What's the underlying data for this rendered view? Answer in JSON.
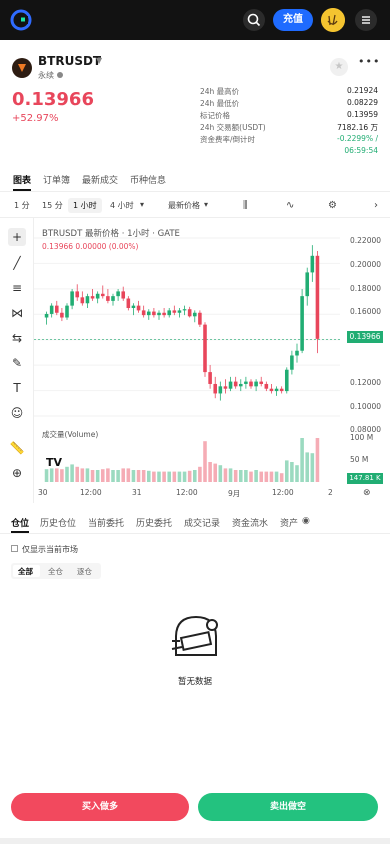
{
  "header": {
    "logo_icon": "gate-logo-icon",
    "search_icon": "search-icon",
    "deposit_label": "充值",
    "avatar_icon": "peace-hand-avatar",
    "menu_icon": "hamburger-menu-icon"
  },
  "ticker": {
    "symbol": "BTRUSDT",
    "type": "永续",
    "last_price": "0.13966",
    "change_pct": "+52.97%",
    "stats": [
      {
        "label": "24h 最高价",
        "value": "0.21924"
      },
      {
        "label": "24h 最低价",
        "value": "0.08229"
      },
      {
        "label": "标记价格",
        "value": "0.13959"
      },
      {
        "label": "24h 交易额(USDT)",
        "value": "7182.16 万"
      },
      {
        "label": "资金费率/倒计时",
        "value": "-0.2299% /"
      }
    ],
    "countdown": "06:59:54"
  },
  "tabs": [
    "图表",
    "订单簿",
    "最新成交",
    "币种信息"
  ],
  "toolbar": {
    "timeframes": [
      "1 分",
      "15 分",
      "1 小时",
      "4 小时"
    ],
    "active_tf": "1 小时",
    "price_type": "最新价格"
  },
  "chart": {
    "legend": "BTRUSDT 最新价格 · 1小时 · GATE",
    "legend_values": "0.13966  0.00000 (0.00%)",
    "volume_legend": "成交量(Volume)",
    "price_tag": "0.13966",
    "volume_tag": "147.81 K",
    "y_ticks": [
      "0.22000",
      "0.20000",
      "0.18000",
      "0.16000",
      "0.12000",
      "0.10000",
      "0.08000"
    ],
    "vol_ticks": [
      "100 M",
      "50 M"
    ],
    "x_ticks": [
      "30",
      "12:00",
      "31",
      "12:00",
      "9月",
      "12:00",
      "2"
    ]
  },
  "chart_data": {
    "type": "candlestick",
    "title": "BTRUSDT 最新价格 · 1小时 · GATE",
    "ylabel": "",
    "ylim": [
      0.075,
      0.225
    ],
    "candles": [
      [
        0.158,
        0.163,
        0.152,
        0.161
      ],
      [
        0.161,
        0.17,
        0.158,
        0.168
      ],
      [
        0.168,
        0.172,
        0.16,
        0.162
      ],
      [
        0.162,
        0.166,
        0.155,
        0.158
      ],
      [
        0.158,
        0.17,
        0.156,
        0.168
      ],
      [
        0.168,
        0.182,
        0.165,
        0.18
      ],
      [
        0.18,
        0.186,
        0.172,
        0.175
      ],
      [
        0.175,
        0.18,
        0.168,
        0.17
      ],
      [
        0.17,
        0.178,
        0.166,
        0.176
      ],
      [
        0.176,
        0.182,
        0.172,
        0.174
      ],
      [
        0.174,
        0.18,
        0.17,
        0.178
      ],
      [
        0.178,
        0.185,
        0.174,
        0.176
      ],
      [
        0.176,
        0.182,
        0.17,
        0.172
      ],
      [
        0.172,
        0.178,
        0.168,
        0.176
      ],
      [
        0.176,
        0.182,
        0.172,
        0.18
      ],
      [
        0.18,
        0.184,
        0.172,
        0.174
      ],
      [
        0.174,
        0.176,
        0.164,
        0.166
      ],
      [
        0.166,
        0.17,
        0.16,
        0.168
      ],
      [
        0.168,
        0.172,
        0.162,
        0.164
      ],
      [
        0.164,
        0.168,
        0.158,
        0.16
      ],
      [
        0.16,
        0.165,
        0.156,
        0.163
      ],
      [
        0.163,
        0.166,
        0.158,
        0.16
      ],
      [
        0.16,
        0.164,
        0.156,
        0.162
      ],
      [
        0.162,
        0.166,
        0.158,
        0.16
      ],
      [
        0.16,
        0.166,
        0.158,
        0.164
      ],
      [
        0.164,
        0.168,
        0.16,
        0.162
      ],
      [
        0.162,
        0.166,
        0.158,
        0.164
      ],
      [
        0.164,
        0.168,
        0.16,
        0.165
      ],
      [
        0.165,
        0.167,
        0.158,
        0.159
      ],
      [
        0.159,
        0.164,
        0.154,
        0.162
      ],
      [
        0.162,
        0.164,
        0.15,
        0.152
      ],
      [
        0.152,
        0.154,
        0.108,
        0.112
      ],
      [
        0.112,
        0.118,
        0.098,
        0.102
      ],
      [
        0.102,
        0.108,
        0.09,
        0.094
      ],
      [
        0.094,
        0.104,
        0.088,
        0.1
      ],
      [
        0.1,
        0.106,
        0.094,
        0.098
      ],
      [
        0.098,
        0.108,
        0.096,
        0.104
      ],
      [
        0.104,
        0.108,
        0.098,
        0.1
      ],
      [
        0.1,
        0.106,
        0.096,
        0.102
      ],
      [
        0.102,
        0.108,
        0.098,
        0.104
      ],
      [
        0.104,
        0.106,
        0.098,
        0.1
      ],
      [
        0.1,
        0.106,
        0.096,
        0.104
      ],
      [
        0.104,
        0.108,
        0.1,
        0.102
      ],
      [
        0.102,
        0.104,
        0.096,
        0.098
      ],
      [
        0.098,
        0.102,
        0.094,
        0.096
      ],
      [
        0.096,
        0.1,
        0.092,
        0.098
      ],
      [
        0.098,
        0.1,
        0.094,
        0.096
      ],
      [
        0.096,
        0.116,
        0.094,
        0.114
      ],
      [
        0.114,
        0.13,
        0.11,
        0.126
      ],
      [
        0.126,
        0.136,
        0.12,
        0.13
      ],
      [
        0.13,
        0.182,
        0.128,
        0.176
      ],
      [
        0.176,
        0.2,
        0.168,
        0.196
      ],
      [
        0.196,
        0.219,
        0.188,
        0.21
      ],
      [
        0.21,
        0.214,
        0.128,
        0.14
      ]
    ],
    "volume_ticks": [
      "100 M",
      "50 M"
    ]
  },
  "positions": {
    "tabs": [
      "仓位",
      "历史仓位",
      "当前委托",
      "历史委托",
      "成交记录",
      "资金流水",
      "资产"
    ],
    "only_current": "仅显示当前市场",
    "segments": [
      "全部",
      "全仓",
      "逐仓"
    ],
    "empty": "暂无数据"
  },
  "actions": {
    "buy": "买入做多",
    "sell": "卖出做空"
  },
  "colors": {
    "up": "#21ad73",
    "down": "#e8465b",
    "accent": "#1f6bff"
  }
}
